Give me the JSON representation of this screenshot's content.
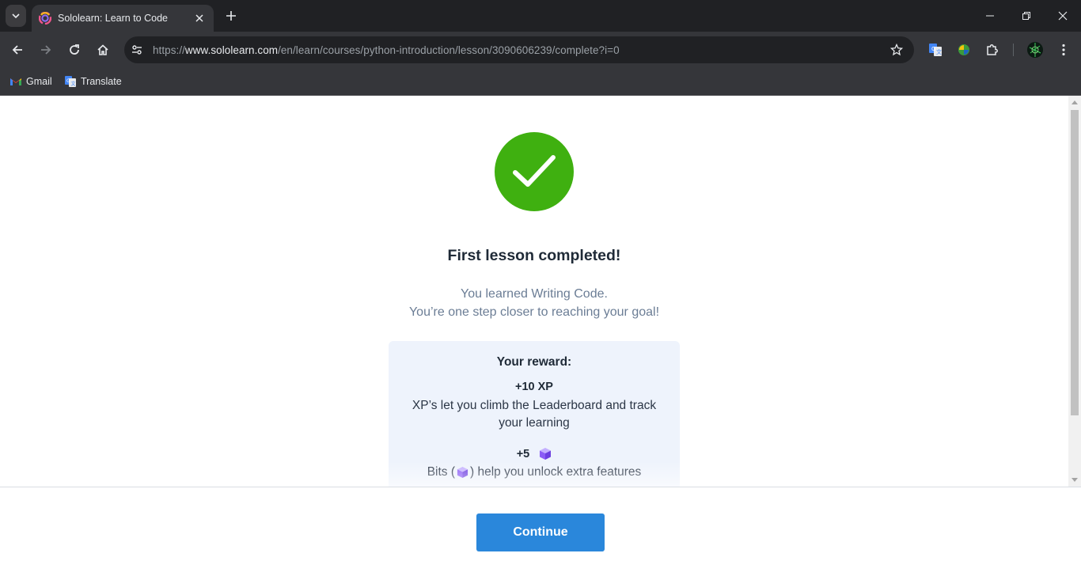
{
  "browser": {
    "tab_title": "Sololearn: Learn to Code",
    "url_prefix": "https://",
    "url_host": "www.sololearn.com",
    "url_path": "/en/learn/courses/python-introduction/lesson/3090606239/complete?i=0",
    "bookmarks": [
      {
        "label": "Gmail",
        "icon": "gmail-icon"
      },
      {
        "label": "Translate",
        "icon": "translate-icon"
      }
    ]
  },
  "lesson_complete": {
    "heading": "First lesson completed!",
    "subtitle_line1": "You learned Writing Code.",
    "subtitle_line2": "You’re one step closer to reaching your goal!",
    "reward": {
      "title": "Your reward:",
      "xp_amount": "+10 XP",
      "xp_description": "XP’s let you climb the Leaderboard and track your learning",
      "bits_amount": "+5",
      "bits_desc_prefix": "Bits (",
      "bits_desc_suffix": ") help you unlock extra features"
    },
    "continue_label": "Continue"
  },
  "colors": {
    "success_green": "#3fb010",
    "primary_blue": "#2a87db",
    "reward_bg": "#eef3fc",
    "bits_purple": "#8b5cf6"
  }
}
